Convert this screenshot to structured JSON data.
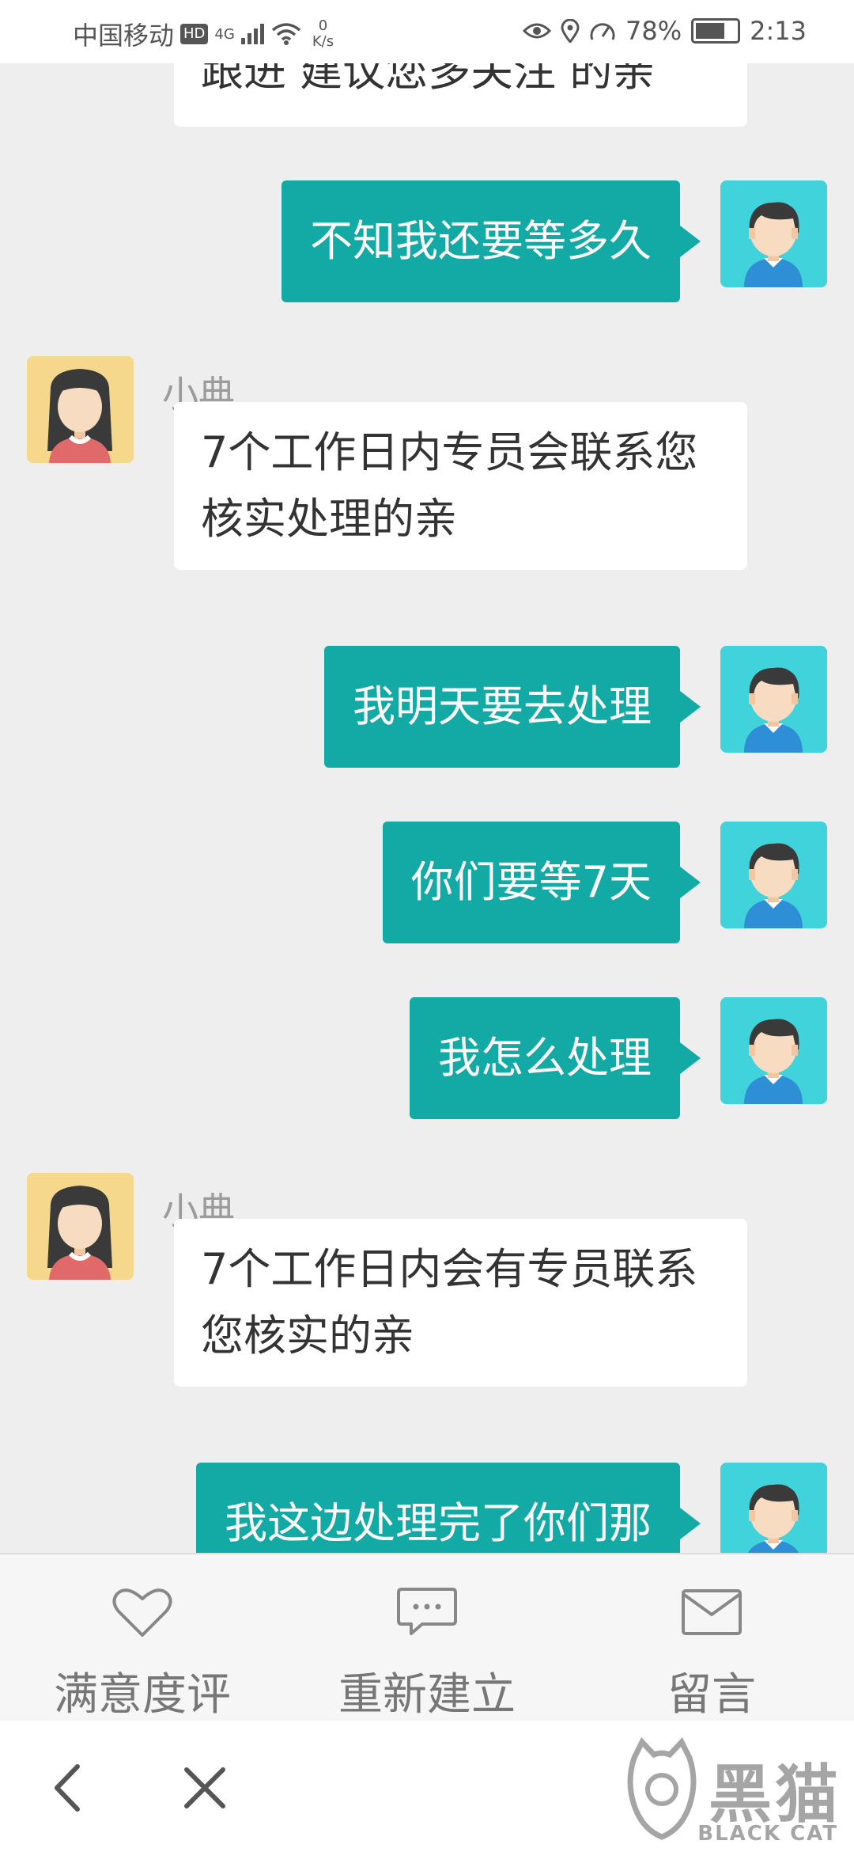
{
  "status_bar": {
    "carrier": "中国移动",
    "hd": "HD",
    "network": "4G",
    "speed_value": "0",
    "speed_unit": "K/s",
    "battery": "78%",
    "time": "2:13"
  },
  "chat": {
    "messages": [
      {
        "from": "agent",
        "text": "跟进 建议您多关注 的亲"
      },
      {
        "from": "user",
        "text": "不知我还要等多久"
      },
      {
        "from": "agent",
        "name": "小典",
        "text": "7个工作日内专员会联系您核实处理的亲"
      },
      {
        "from": "user",
        "text": "我明天要去处理"
      },
      {
        "from": "user",
        "text": "你们要等7天"
      },
      {
        "from": "user",
        "text": "我怎么处理"
      },
      {
        "from": "agent",
        "name": "小典",
        "text": "7个工作日内会有专员联系您核实的亲"
      },
      {
        "from": "user",
        "text": "我这边处理完了你们那"
      }
    ]
  },
  "actions": [
    {
      "label": "满意度评",
      "icon": "heart-icon"
    },
    {
      "label": "重新建立",
      "icon": "chat-bubble-icon"
    },
    {
      "label": "留言",
      "icon": "envelope-icon"
    }
  ],
  "nav": {
    "back_icon": "chevron-left-icon",
    "close_icon": "close-icon"
  },
  "watermark": {
    "text": "黑猫",
    "sub": "BLACK CAT"
  },
  "colors": {
    "user_bubble": "#13aaa6",
    "agent_bubble": "#ffffff",
    "background": "#eeeeee"
  }
}
